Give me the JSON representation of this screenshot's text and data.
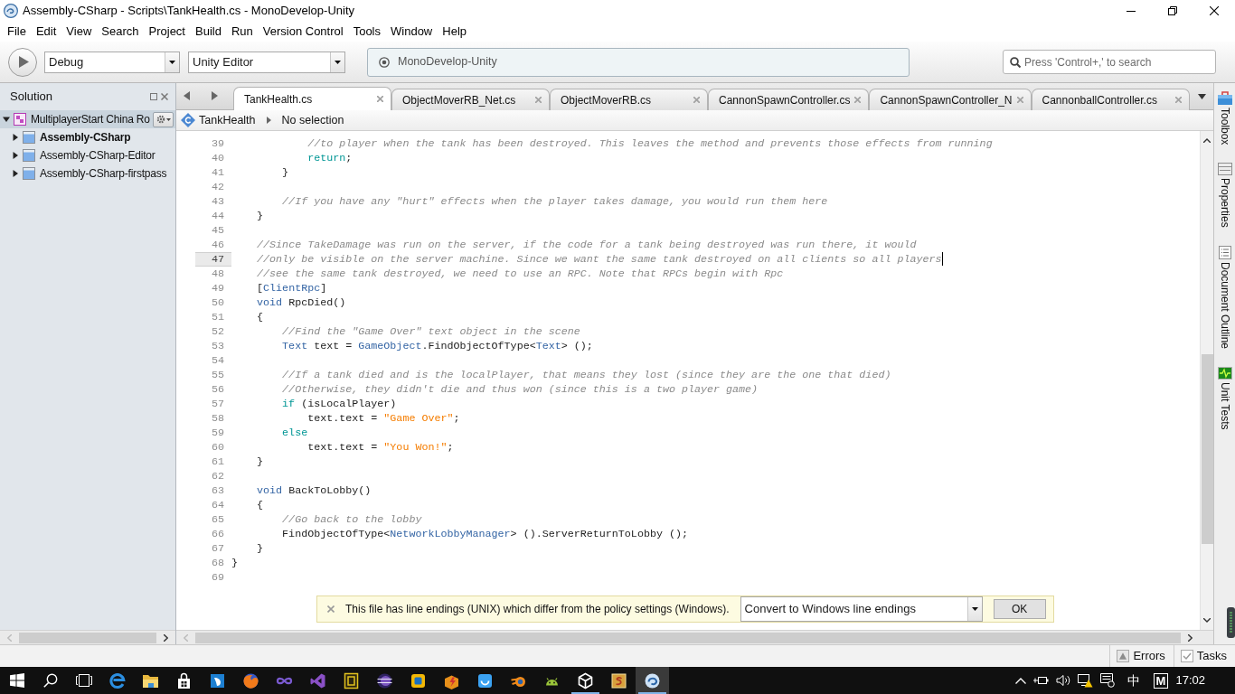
{
  "window": {
    "title": "Assembly-CSharp - Scripts\\TankHealth.cs - MonoDevelop-Unity"
  },
  "menu": [
    "File",
    "Edit",
    "View",
    "Search",
    "Project",
    "Build",
    "Run",
    "Version Control",
    "Tools",
    "Window",
    "Help"
  ],
  "toolbar": {
    "configuration": "Debug",
    "target": "Unity Editor",
    "status": "MonoDevelop-Unity",
    "search": {
      "placeholder": "Press 'Control+,' to search"
    }
  },
  "solution_pad": {
    "title": "Solution",
    "tree": [
      {
        "kind": "solution",
        "label": "MultiplayerStart China Ro",
        "selected": true,
        "expanded": true,
        "startup": false,
        "children": [
          {
            "kind": "project",
            "label": "Assembly-CSharp",
            "selected": false,
            "expanded": false,
            "startup": true
          },
          {
            "kind": "project",
            "label": "Assembly-CSharp-Editor",
            "selected": false,
            "expanded": false,
            "startup": false
          },
          {
            "kind": "project",
            "label": "Assembly-CSharp-firstpass",
            "selected": false,
            "expanded": false,
            "startup": false
          }
        ]
      }
    ]
  },
  "tabs": [
    {
      "label": "TankHealth.cs",
      "selected": true
    },
    {
      "label": "ObjectMoverRB_Net.cs",
      "selected": false
    },
    {
      "label": "ObjectMoverRB.cs",
      "selected": false
    },
    {
      "label": "CannonSpawnController.cs",
      "selected": false
    },
    {
      "label": "CannonSpawnController_N",
      "selected": false
    },
    {
      "label": "CannonballController.cs",
      "selected": false
    }
  ],
  "breadcrumb": {
    "type": "TankHealth",
    "member": "No selection"
  },
  "editor": {
    "lines": [
      {
        "number": "39",
        "current": false,
        "tokens": [
          {
            "kind": "comment",
            "text": "            //to player when the tank has been destroyed. This leaves the method and prevents those effects from running"
          }
        ]
      },
      {
        "number": "40",
        "current": false,
        "tokens": [
          {
            "kind": "control",
            "text": "            return"
          },
          {
            "kind": "plain",
            "text": ";"
          }
        ]
      },
      {
        "number": "41",
        "current": false,
        "tokens": [
          {
            "kind": "plain",
            "text": "        }"
          }
        ]
      },
      {
        "number": "42",
        "current": false
      },
      {
        "number": "43",
        "current": false,
        "tokens": [
          {
            "kind": "comment",
            "text": "        //If you have any \"hurt\" effects when the player takes damage, you would run them here"
          }
        ]
      },
      {
        "number": "44",
        "current": false,
        "tokens": [
          {
            "kind": "plain",
            "text": "    }"
          }
        ]
      },
      {
        "number": "45",
        "current": false
      },
      {
        "number": "46",
        "current": false,
        "tokens": [
          {
            "kind": "comment",
            "text": "    //Since TakeDamage was run on the server, if the code for a tank being destroyed was run there, it would"
          }
        ]
      },
      {
        "number": "47",
        "current": true,
        "tokens": [
          {
            "kind": "comment",
            "text": "    //only be visible on the server machine. Since we want the same tank destroyed on all clients so all players"
          }
        ]
      },
      {
        "number": "48",
        "current": false,
        "tokens": [
          {
            "kind": "comment",
            "text": "    //see the same tank destroyed, we need to use an RPC. Note that RPCs begin with Rpc"
          }
        ]
      },
      {
        "number": "49",
        "current": false,
        "tokens": [
          {
            "kind": "plain",
            "text": "    ["
          },
          {
            "kind": "type",
            "text": "ClientRpc"
          },
          {
            "kind": "plain",
            "text": "]"
          }
        ]
      },
      {
        "number": "50",
        "current": false,
        "tokens": [
          {
            "kind": "keyword",
            "text": "    void"
          },
          {
            "kind": "plain",
            "text": " RpcDied()"
          }
        ]
      },
      {
        "number": "51",
        "current": false,
        "tokens": [
          {
            "kind": "plain",
            "text": "    {"
          }
        ]
      },
      {
        "number": "52",
        "current": false,
        "tokens": [
          {
            "kind": "comment",
            "text": "        //Find the \"Game Over\" text object in the scene"
          }
        ]
      },
      {
        "number": "53",
        "current": false,
        "tokens": [
          {
            "kind": "type",
            "text": "        Text"
          },
          {
            "kind": "plain",
            "text": " text = "
          },
          {
            "kind": "type",
            "text": "GameObject"
          },
          {
            "kind": "plain",
            "text": ".FindObjectOfType<"
          },
          {
            "kind": "type",
            "text": "Text"
          },
          {
            "kind": "plain",
            "text": "> ();"
          }
        ]
      },
      {
        "number": "54",
        "current": false
      },
      {
        "number": "55",
        "current": false,
        "tokens": [
          {
            "kind": "comment",
            "text": "        //If a tank died and is the localPlayer, that means they lost (since they are the one that died)"
          }
        ]
      },
      {
        "number": "56",
        "current": false,
        "tokens": [
          {
            "kind": "comment",
            "text": "        //Otherwise, they didn't die and thus won (since this is a two player game)"
          }
        ]
      },
      {
        "number": "57",
        "current": false,
        "tokens": [
          {
            "kind": "control",
            "text": "        if"
          },
          {
            "kind": "plain",
            "text": " (isLocalPlayer)"
          }
        ]
      },
      {
        "number": "58",
        "current": false,
        "tokens": [
          {
            "kind": "plain",
            "text": "            text.text = "
          },
          {
            "kind": "string",
            "text": "\"Game Over\""
          },
          {
            "kind": "plain",
            "text": ";"
          }
        ]
      },
      {
        "number": "59",
        "current": false,
        "tokens": [
          {
            "kind": "control",
            "text": "        else"
          }
        ]
      },
      {
        "number": "60",
        "current": false,
        "tokens": [
          {
            "kind": "plain",
            "text": "            text.text = "
          },
          {
            "kind": "string",
            "text": "\"You Won!\""
          },
          {
            "kind": "plain",
            "text": ";"
          }
        ]
      },
      {
        "number": "61",
        "current": false,
        "tokens": [
          {
            "kind": "plain",
            "text": "    }"
          }
        ]
      },
      {
        "number": "62",
        "current": false
      },
      {
        "number": "63",
        "current": false,
        "tokens": [
          {
            "kind": "keyword",
            "text": "    void"
          },
          {
            "kind": "plain",
            "text": " BackToLobby()"
          }
        ]
      },
      {
        "number": "64",
        "current": false,
        "tokens": [
          {
            "kind": "plain",
            "text": "    {"
          }
        ]
      },
      {
        "number": "65",
        "current": false,
        "tokens": [
          {
            "kind": "comment",
            "text": "        //Go back to the lobby"
          }
        ]
      },
      {
        "number": "66",
        "current": false,
        "tokens": [
          {
            "kind": "plain",
            "text": "        FindObjectOfType<"
          },
          {
            "kind": "type",
            "text": "NetworkLobbyManager"
          },
          {
            "kind": "plain",
            "text": "> ().ServerReturnToLobby ();"
          }
        ]
      },
      {
        "number": "67",
        "current": false,
        "tokens": [
          {
            "kind": "plain",
            "text": "    }"
          }
        ]
      },
      {
        "number": "68",
        "current": false,
        "tokens": [
          {
            "kind": "plain",
            "text": "}"
          }
        ]
      },
      {
        "number": "69",
        "current": false
      }
    ]
  },
  "notification": {
    "message": "This file has line endings (UNIX) which differ from the policy settings (Windows).",
    "action": "Convert to Windows line endings",
    "button": "OK"
  },
  "dock": [
    {
      "kind": "toolbox",
      "label": "Toolbox"
    },
    {
      "kind": "properties",
      "label": "Properties"
    },
    {
      "kind": "outline",
      "label": "Document Outline"
    },
    {
      "kind": "tests",
      "label": "Unit Tests"
    }
  ],
  "status_bar": {
    "pads": [
      {
        "kind": "errors",
        "label": "Errors"
      },
      {
        "kind": "tasks",
        "label": "Tasks"
      }
    ]
  },
  "taskbar": {
    "apps": [
      {
        "kind": "browser",
        "running": false,
        "selected": false
      },
      {
        "kind": "folder",
        "running": false,
        "selected": false
      },
      {
        "kind": "store",
        "running": false,
        "selected": false
      },
      {
        "kind": "bluetile",
        "running": false,
        "selected": false
      },
      {
        "kind": "globe",
        "running": false,
        "selected": false
      },
      {
        "kind": "infinity",
        "running": false,
        "selected": false
      },
      {
        "kind": "bracket",
        "running": false,
        "selected": false
      },
      {
        "kind": "tile",
        "running": false,
        "selected": false
      },
      {
        "kind": "sphere",
        "running": false,
        "selected": false
      },
      {
        "kind": "square",
        "running": false,
        "selected": false
      },
      {
        "kind": "box",
        "running": false,
        "selected": false
      },
      {
        "kind": "bubble",
        "running": false,
        "selected": false
      },
      {
        "kind": "orbit",
        "running": false,
        "selected": false
      },
      {
        "kind": "robot",
        "running": false,
        "selected": false
      },
      {
        "kind": "cube",
        "running": true,
        "selected": false
      },
      {
        "kind": "scroll",
        "running": false,
        "selected": false
      },
      {
        "kind": "swirl",
        "running": true,
        "selected": true
      }
    ],
    "tray": {
      "language": "中",
      "input_mode": "M",
      "time": "17:02"
    }
  }
}
